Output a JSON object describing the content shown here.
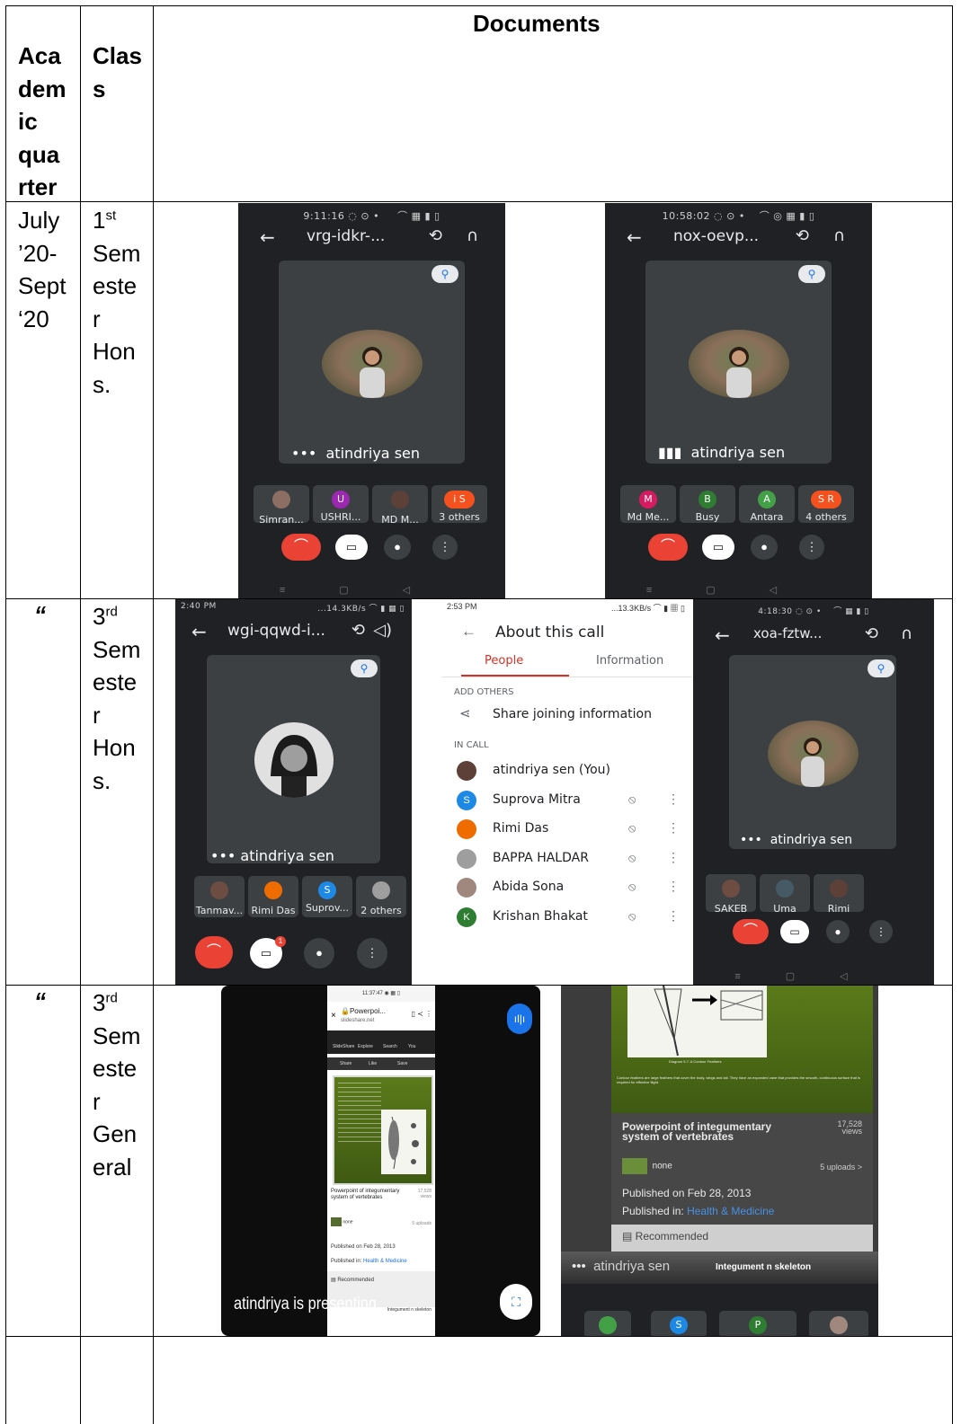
{
  "table": {
    "headers": {
      "quarter": [
        "Aca",
        "dem",
        "ic",
        "qua",
        "rter"
      ],
      "class": [
        "Clas",
        "s"
      ],
      "documents": "Documents"
    },
    "rows": [
      {
        "quarter_lines": [
          "July",
          "’20-",
          "Sept",
          "‘20"
        ],
        "class_ord": "1",
        "class_sup": "st",
        "class_lines": [
          "Sem",
          "este",
          "r",
          "Hon",
          "s."
        ]
      },
      {
        "quarter_lines": [
          "“"
        ],
        "class_ord": "3",
        "class_sup": "rd",
        "class_lines": [
          "Sem",
          "este",
          "r",
          "Hon",
          "s."
        ]
      },
      {
        "quarter_lines": [
          "“"
        ],
        "class_ord": "3",
        "class_sup": "rd",
        "class_lines": [
          "Sem",
          "este",
          "r",
          "Gen",
          "eral"
        ]
      }
    ]
  },
  "shots": {
    "s1": {
      "status": "9:11:16",
      "code": "vrg-idkr-...",
      "name": "atindriya sen",
      "chips": [
        {
          "label": "Simran...",
          "color": "#8d6e63",
          "initial": ""
        },
        {
          "label": "USHRI...",
          "color": "#9c27b0",
          "initial": "U"
        },
        {
          "label": "MD M...",
          "color": "#5d4037",
          "initial": ""
        },
        {
          "label": "3 others",
          "color": "#f4511e",
          "initial": "i S"
        }
      ]
    },
    "s2": {
      "status": "10:58:02",
      "code": "nox-oevp...",
      "name": "atindriya sen",
      "chips": [
        {
          "label": "Md Me...",
          "color": "#d81b60",
          "initial": "M"
        },
        {
          "label": "Busy",
          "color": "#2e7d32",
          "initial": "B"
        },
        {
          "label": "Antara",
          "color": "#43a047",
          "initial": "A"
        },
        {
          "label": "4 others",
          "color": "#f4511e",
          "initial": "S R"
        }
      ]
    },
    "s3": {
      "status": "2:40 PM",
      "status_right": "...14.3KB/s",
      "code": "wgi-qqwd-i...",
      "name": "atindriya sen",
      "chips": [
        {
          "label": "Tanmav...",
          "color": "#6d4c41",
          "initial": ""
        },
        {
          "label": "Rimi Das",
          "color": "#ef6c00",
          "initial": ""
        },
        {
          "label": "Suprov...",
          "color": "#1e88e5",
          "initial": "S"
        },
        {
          "label": "2 others",
          "color": "#9e9e9e",
          "initial": ""
        }
      ],
      "badge": "1"
    },
    "s4": {
      "status": "2:53 PM",
      "status_right": "...13.3KB/s",
      "title": "About this call",
      "tab_people": "People",
      "tab_info": "Information",
      "add_others": "ADD OTHERS",
      "share": "Share joining information",
      "in_call": "IN CALL",
      "people": [
        {
          "name": "atindriya sen (You)",
          "color": "#5d4037",
          "initial": ""
        },
        {
          "name": "Suprova Mitra",
          "color": "#1e88e5",
          "initial": "S"
        },
        {
          "name": "Rimi Das",
          "color": "#ef6c00",
          "initial": ""
        },
        {
          "name": "BAPPA HALDAR",
          "color": "#9e9e9e",
          "initial": ""
        },
        {
          "name": "Abida Sona",
          "color": "#a1887f",
          "initial": ""
        },
        {
          "name": "Krishan Bhakat",
          "color": "#2e7d32",
          "initial": "K"
        }
      ]
    },
    "s5": {
      "status": "4:18:30",
      "code": "xoa-fztw...",
      "name": "atindriya sen",
      "chips": [
        {
          "label": "SAKEB",
          "color": "#6d4c41",
          "initial": ""
        },
        {
          "label": "Uma",
          "color": "#455a64",
          "initial": ""
        },
        {
          "label": "Rimi",
          "color": "#5d4037",
          "initial": ""
        }
      ]
    },
    "s6": {
      "status": "11:37:47",
      "url": "Powerpoi...",
      "domain": "slideshare.net",
      "nav": [
        "SlideShare",
        "Explore",
        "Search",
        "You"
      ],
      "actions": [
        "Share",
        "Like",
        "Save"
      ],
      "slide_title": "Powerpoint of integumentary system of vertebrates",
      "views": "17,528",
      "views_label": "views",
      "author": "none",
      "uploads": "5 uploads",
      "published": "Published on Feb 28, 2013",
      "published_in": "Published in:",
      "category": "Health & Medicine",
      "recommended": "Recommended",
      "next": "Integument n skeleton",
      "presenting": "atindriya is presenting"
    },
    "s7": {
      "caption": "Diagram 5.7: A Contour Feathers",
      "slide_text": "Contour feathers are large feathers that cover the body, wings and tail. They have an expanded vane that provides the smooth, continuous surface that is required for effective flight.",
      "slide_title": "Powerpoint of integumentary system of vertebrates",
      "views": "17,528",
      "views_label": "views",
      "author": "none",
      "uploads": "5 uploads >",
      "published": "Published on Feb 28, 2013",
      "published_in": "Published in:",
      "category": "Health & Medicine",
      "recommended": "Recommended",
      "name": "atindriya sen",
      "next": "Integument n skeleton"
    }
  }
}
